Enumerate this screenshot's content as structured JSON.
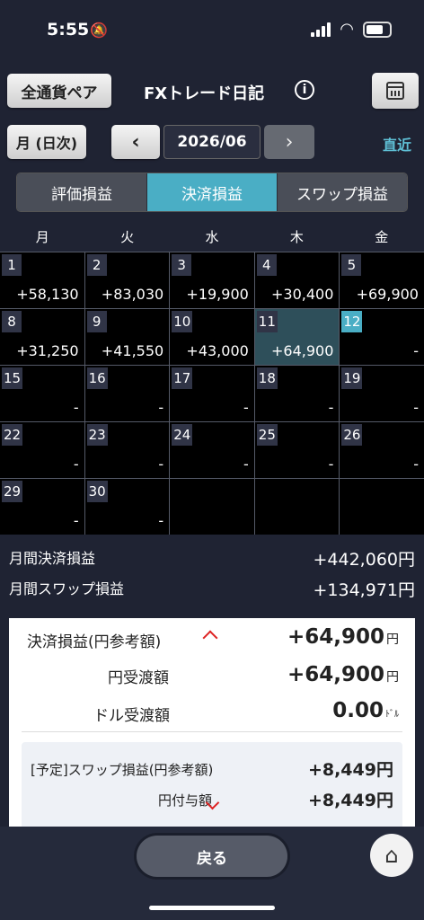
{
  "status": {
    "time": "5:55"
  },
  "header": {
    "pair_button": "全通貨ペア",
    "title": "FXトレード日記",
    "info_icon": "info-icon",
    "calendar_icon": "calendar-icon"
  },
  "nav": {
    "mode": "月 (日次)",
    "prev": "‹",
    "date": "2026/06",
    "next": "›",
    "recent": "直近"
  },
  "tabs": [
    {
      "label": "評価損益"
    },
    {
      "label": "決済損益",
      "active": true
    },
    {
      "label": "スワップ損益"
    }
  ],
  "weekdays": [
    "月",
    "火",
    "水",
    "木",
    "金"
  ],
  "weeks": [
    [
      {
        "day": "1",
        "pl": "+58,130"
      },
      {
        "day": "2",
        "pl": "+83,030"
      },
      {
        "day": "3",
        "pl": "+19,900"
      },
      {
        "day": "4",
        "pl": "+30,400"
      },
      {
        "day": "5",
        "pl": "+69,900"
      }
    ],
    [
      {
        "day": "8",
        "pl": "+31,250"
      },
      {
        "day": "9",
        "pl": "+41,550"
      },
      {
        "day": "10",
        "pl": "+43,000"
      },
      {
        "day": "11",
        "pl": "+64,900",
        "selected": true
      },
      {
        "day": "12",
        "pl": "-",
        "today": true
      }
    ],
    [
      {
        "day": "15",
        "pl": "-"
      },
      {
        "day": "16",
        "pl": "-"
      },
      {
        "day": "17",
        "pl": "-"
      },
      {
        "day": "18",
        "pl": "-"
      },
      {
        "day": "19",
        "pl": "-"
      }
    ],
    [
      {
        "day": "22",
        "pl": "-"
      },
      {
        "day": "23",
        "pl": "-"
      },
      {
        "day": "24",
        "pl": "-"
      },
      {
        "day": "25",
        "pl": "-"
      },
      {
        "day": "26",
        "pl": "-"
      }
    ],
    [
      {
        "day": "29",
        "pl": "-"
      },
      {
        "day": "30",
        "pl": "-"
      },
      {
        "day": "",
        "pl": ""
      },
      {
        "day": "",
        "pl": ""
      },
      {
        "day": "",
        "pl": ""
      }
    ]
  ],
  "summary": {
    "settled_label": "月間決済損益",
    "settled_value": "+442,060円",
    "swap_label": "月間スワップ損益",
    "swap_value": "+134,971円"
  },
  "detail": {
    "settled_label": "決済損益(円参考額)",
    "settled_value": "+64,900",
    "settled_unit": "円",
    "yen_label": "円受渡額",
    "yen_value": "+64,900",
    "yen_unit": "円",
    "usd_label": "ドル受渡額",
    "usd_value": "0.00",
    "usd_unit": "ﾄﾞﾙ",
    "swap_label": "[予定]スワップ損益(円参考額)",
    "swap_value": "+8,449",
    "swap_unit": "円",
    "grant_label": "円付与額",
    "grant_value": "+8,449",
    "grant_unit": "円"
  },
  "bottom": {
    "back": "戻る"
  },
  "colors": {
    "accent": "#4aaec5",
    "background": "#1f2333",
    "negative_arrow": "#dd2222"
  }
}
